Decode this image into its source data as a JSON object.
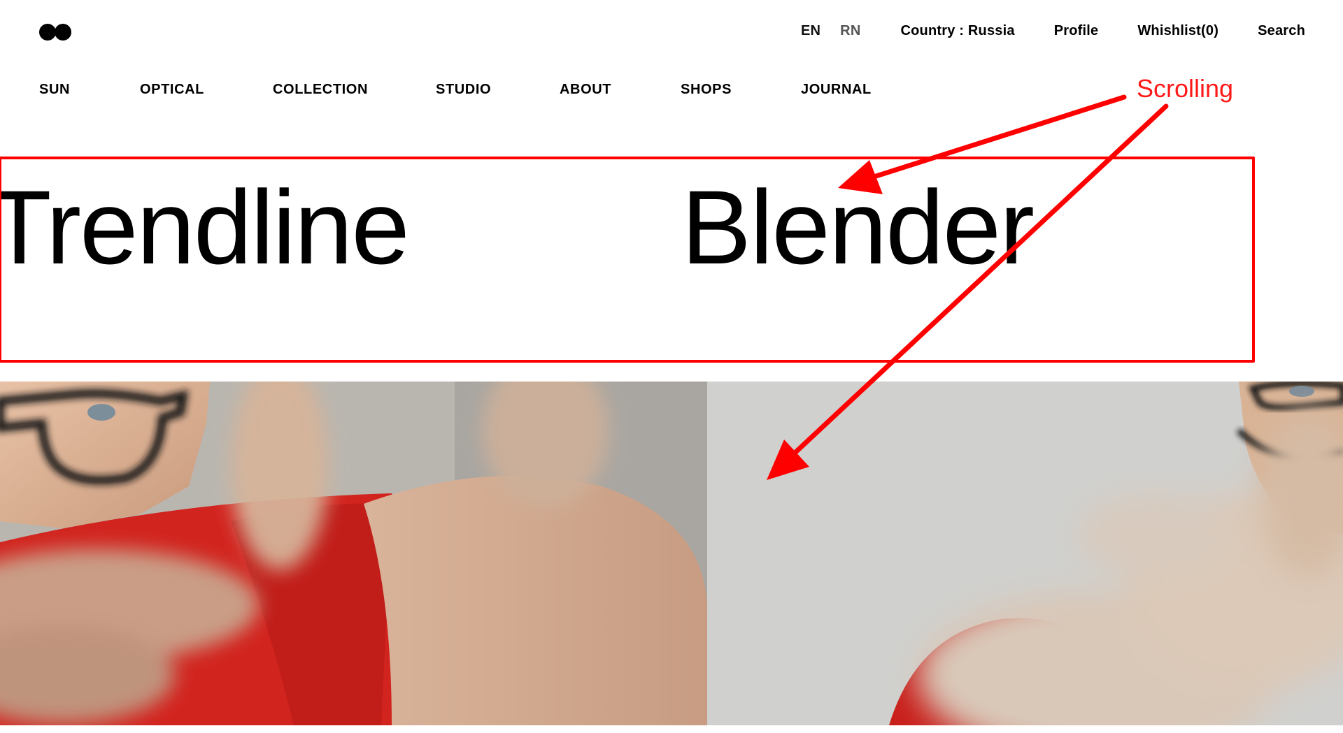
{
  "header": {
    "logo_icon": "two-dots-logo-icon",
    "language": {
      "en": "EN",
      "rn": "RN"
    },
    "country": "Country : Russia",
    "profile": "Profile",
    "wishlist": "Whishlist(0)",
    "search": "Search"
  },
  "nav": {
    "items": [
      "SUN",
      "OPTICAL",
      "COLLECTION",
      "STUDIO",
      "ABOUT",
      "SHOPS",
      "JOURNAL"
    ]
  },
  "marquee": {
    "words": [
      "Trendline",
      "Blender"
    ]
  },
  "annotation": {
    "label": "Scrolling",
    "color": "#ff0000"
  },
  "hero": {
    "left_image": "man-with-glasses-framing-hands-photo",
    "right_image": "man-with-glasses-framing-hands-closeup-photo",
    "shirt_color": "#d2241f"
  }
}
